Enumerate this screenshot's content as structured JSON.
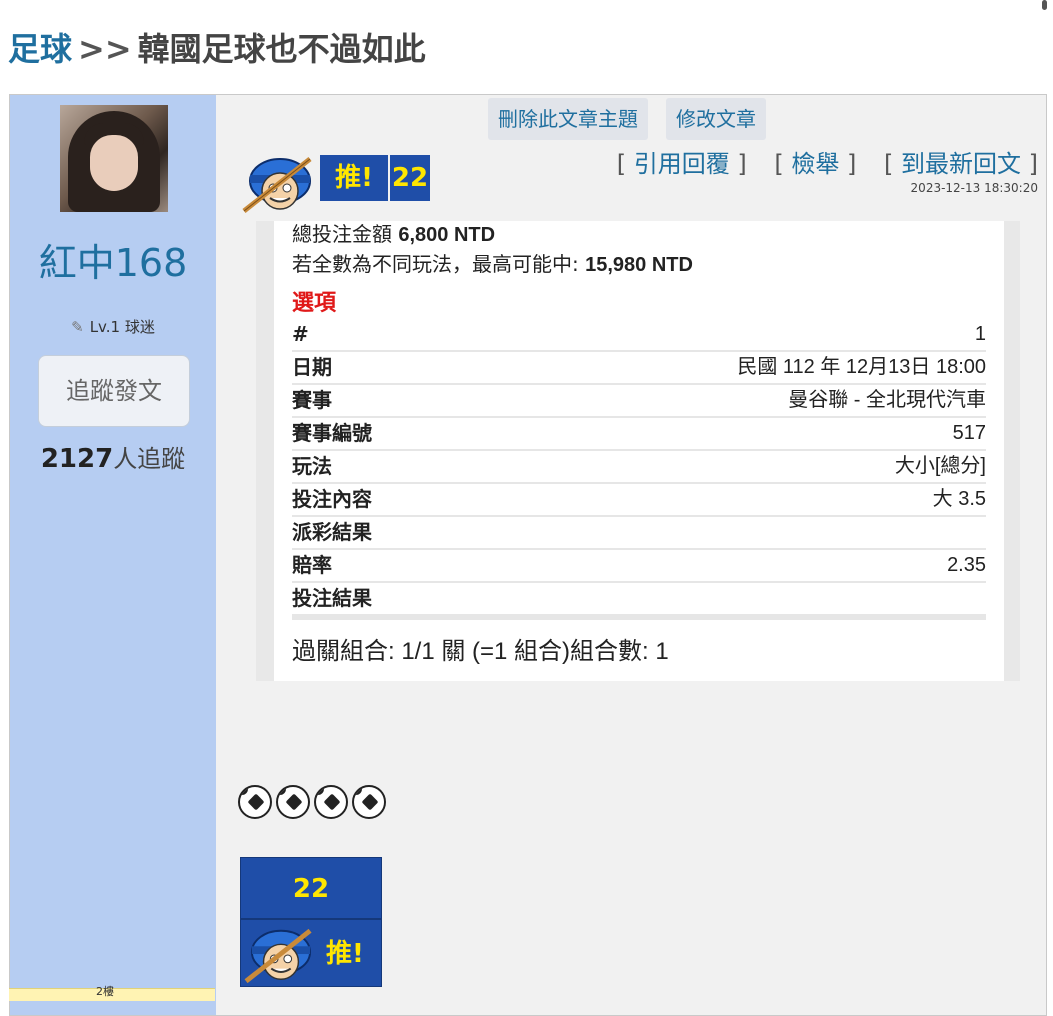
{
  "breadcrumb": {
    "section": "足球",
    "separator": ">>",
    "topic": "韓國足球也不過如此"
  },
  "author": {
    "name": "紅中168",
    "level": "Lv.1 球迷",
    "follow_label": "追蹤發文",
    "followers_count": "2127",
    "followers_suffix": "人追蹤"
  },
  "admin": {
    "delete_label": "刪除此文章主題",
    "edit_label": "修改文章"
  },
  "push": {
    "label": "推!",
    "count": "22"
  },
  "actions": {
    "quote": "引用回覆",
    "report": "檢舉",
    "latest": "到最新回文"
  },
  "timestamp": "2023-12-13 18:30:20",
  "bet": {
    "total_label": "總投注金額",
    "total_value": "6,800 NTD",
    "max_label": "若全數為不同玩法，最高可能中:",
    "max_value": "15,980 NTD",
    "options_title": "選項",
    "rows": [
      {
        "key": "#",
        "value": "1"
      },
      {
        "key": "日期",
        "value": "民國 112 年 12月13日 18:00"
      },
      {
        "key": "賽事",
        "value": "曼谷聯 - 全北現代汽車"
      },
      {
        "key": "賽事編號",
        "value": "517"
      },
      {
        "key": "玩法",
        "value": "大小[總分]"
      },
      {
        "key": "投注內容",
        "value": "大 3.5"
      },
      {
        "key": "派彩結果",
        "value": ""
      },
      {
        "key": "賠率",
        "value": "2.35"
      },
      {
        "key": "投注結果",
        "value": ""
      }
    ],
    "parlay": "過關組合: 1/1 關 (=1 組合)組合數: 1"
  },
  "balls_count": 4,
  "floor": "2樓"
}
